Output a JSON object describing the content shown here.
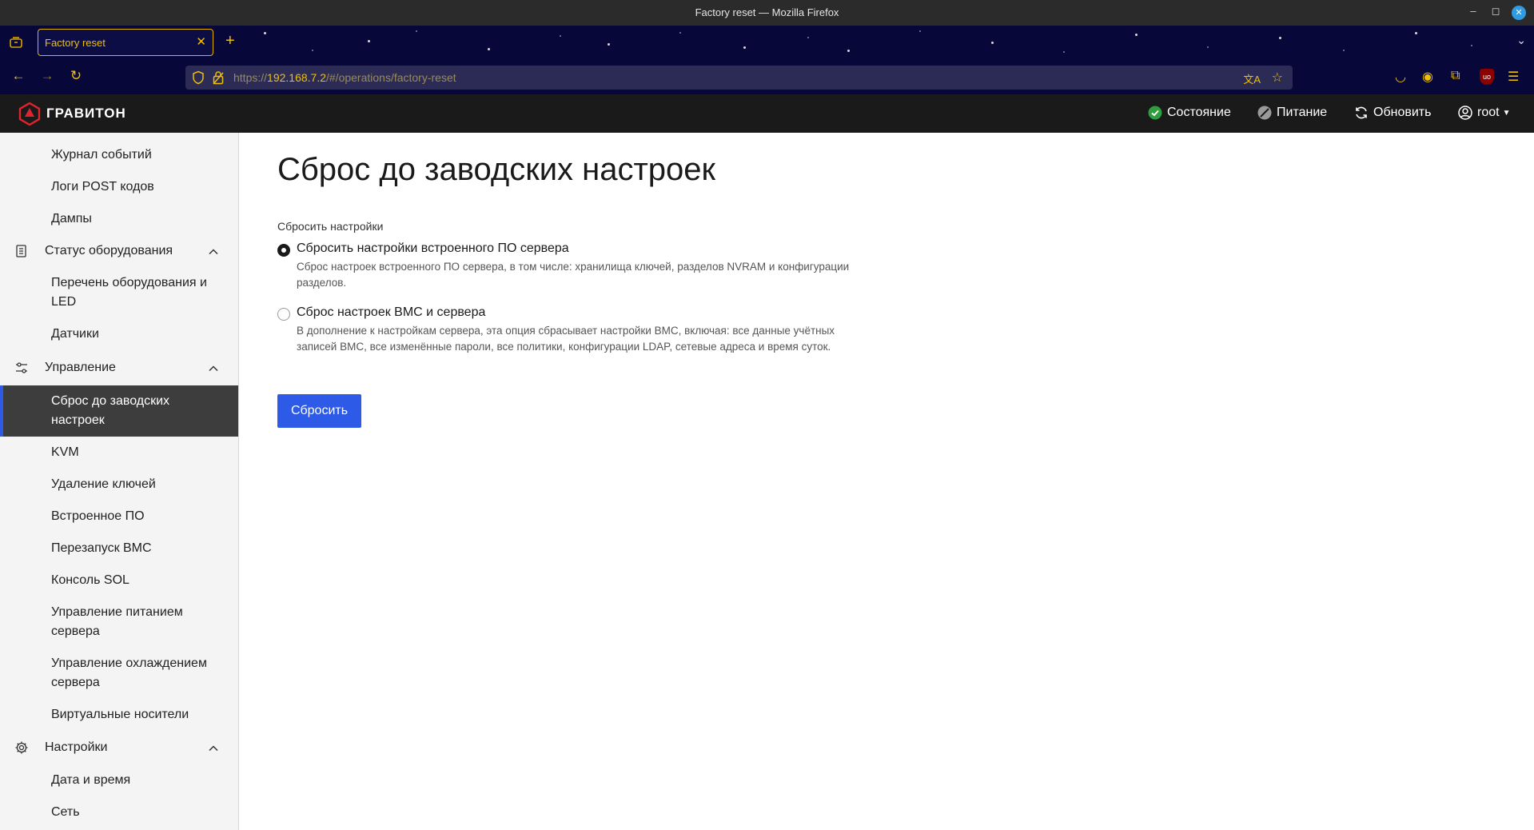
{
  "window": {
    "title": "Factory reset — Mozilla Firefox",
    "controls": {
      "minimize": "–",
      "maximize": "◻",
      "close": "✕"
    }
  },
  "browser": {
    "tab": {
      "title": "Factory reset",
      "close": "✕"
    },
    "newtab_label": "+",
    "tabs_dropdown": "⌄",
    "nav": {
      "back": "←",
      "forward": "→",
      "reload": "↻"
    },
    "url": {
      "scheme": "https://",
      "host": "192.168.7.2",
      "path": "/#/operations/factory-reset"
    },
    "url_icons": {
      "translate": "文A",
      "bookmark": "☆"
    },
    "extensions": {
      "pocket": "◡",
      "account": "◉",
      "puzzle": "⧉",
      "ublock": "uo",
      "menu": "☰"
    }
  },
  "app": {
    "brand": "ГРАВИТОН",
    "accent_color": "#2d5ae6",
    "status_ok_color": "#2e9e3e",
    "header": {
      "status": "Состояние",
      "power": "Питание",
      "refresh": "Обновить",
      "user": "root"
    }
  },
  "sidebar": {
    "items_top": [
      {
        "label": "Журнал событий"
      },
      {
        "label": "Логи POST кодов"
      },
      {
        "label": "Дампы"
      }
    ],
    "hardware": {
      "label": "Статус оборудования",
      "items": [
        {
          "label": "Перечень оборудования и LED"
        },
        {
          "label": "Датчики"
        }
      ]
    },
    "operations": {
      "label": "Управление",
      "items": [
        {
          "label": "Сброс до заводских настроек",
          "active": true
        },
        {
          "label": "KVM"
        },
        {
          "label": "Удаление ключей"
        },
        {
          "label": "Встроенное ПО"
        },
        {
          "label": "Перезапуск BMC"
        },
        {
          "label": "Консоль SOL"
        },
        {
          "label": "Управление питанием сервера"
        },
        {
          "label": "Управление охлаждением сервера"
        },
        {
          "label": "Виртуальные носители"
        }
      ]
    },
    "settings": {
      "label": "Настройки",
      "items": [
        {
          "label": "Дата и время"
        },
        {
          "label": "Сеть"
        }
      ]
    }
  },
  "main": {
    "title": "Сброс до заводских настроек",
    "group_label": "Сбросить настройки",
    "options": [
      {
        "label": "Сбросить настройки встроенного ПО сервера",
        "description": "Сброс настроек встроенного ПО сервера, в том числе: хранилища ключей, разделов NVRAM и конфигурации разделов.",
        "checked": true
      },
      {
        "label": "Сброс настроек BMC и сервера",
        "description": "В дополнение к настройкам сервера, эта опция сбрасывает настройки BMC, включая: все данные учётных записей BMC, все изменённые пароли, все политики, конфигурации LDAP, сетевые адреса и время суток.",
        "checked": false
      }
    ],
    "reset_button": "Сбросить"
  }
}
